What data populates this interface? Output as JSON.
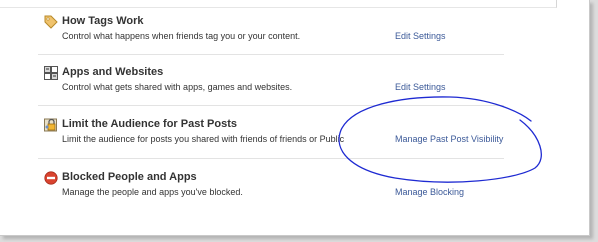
{
  "colors": {
    "link": "#3b5998",
    "text": "#333333",
    "annotation": "#1e2ad2"
  },
  "settings": [
    {
      "title": "How Tags Work",
      "description": "Control what happens when friends tag you or your content.",
      "action": "Edit Settings",
      "icon": "tag-icon"
    },
    {
      "title": "Apps and Websites",
      "description": "Control what gets shared with apps, games and websites.",
      "action": "Edit Settings",
      "icon": "apps-icon"
    },
    {
      "title": "Limit the Audience for Past Posts",
      "description": "Limit the audience for posts you shared with friends of friends or Public",
      "action": "Manage Past Post Visibility",
      "icon": "lock-icon"
    },
    {
      "title": "Blocked People and Apps",
      "description": "Manage the people and apps you've blocked.",
      "action": "Manage Blocking",
      "icon": "block-icon"
    }
  ]
}
